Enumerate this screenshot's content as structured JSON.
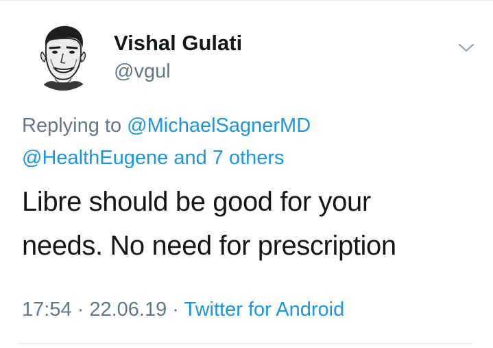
{
  "tweet": {
    "display_name": "Vishal Gulati",
    "handle": "@vgul",
    "replying_prefix": "Replying to ",
    "reply_mention_1": "@MichaelSagnerMD",
    "reply_mention_2": "@HealthEugene",
    "reply_and": " and ",
    "reply_others": "7 others",
    "text_line_1": "Libre should be good for your",
    "text_line_2": "needs. No need for prescription",
    "time": "17:54",
    "sep1": " · ",
    "date": "22.06.19",
    "sep2": " · ",
    "source": "Twitter for Android"
  },
  "icons": {
    "avatar": "avatar-portrait",
    "menu": "chevron-down-icon"
  },
  "colors": {
    "text": "#14171a",
    "secondary": "#657786",
    "link": "#1b95e0",
    "divider": "#e1e8ed"
  }
}
